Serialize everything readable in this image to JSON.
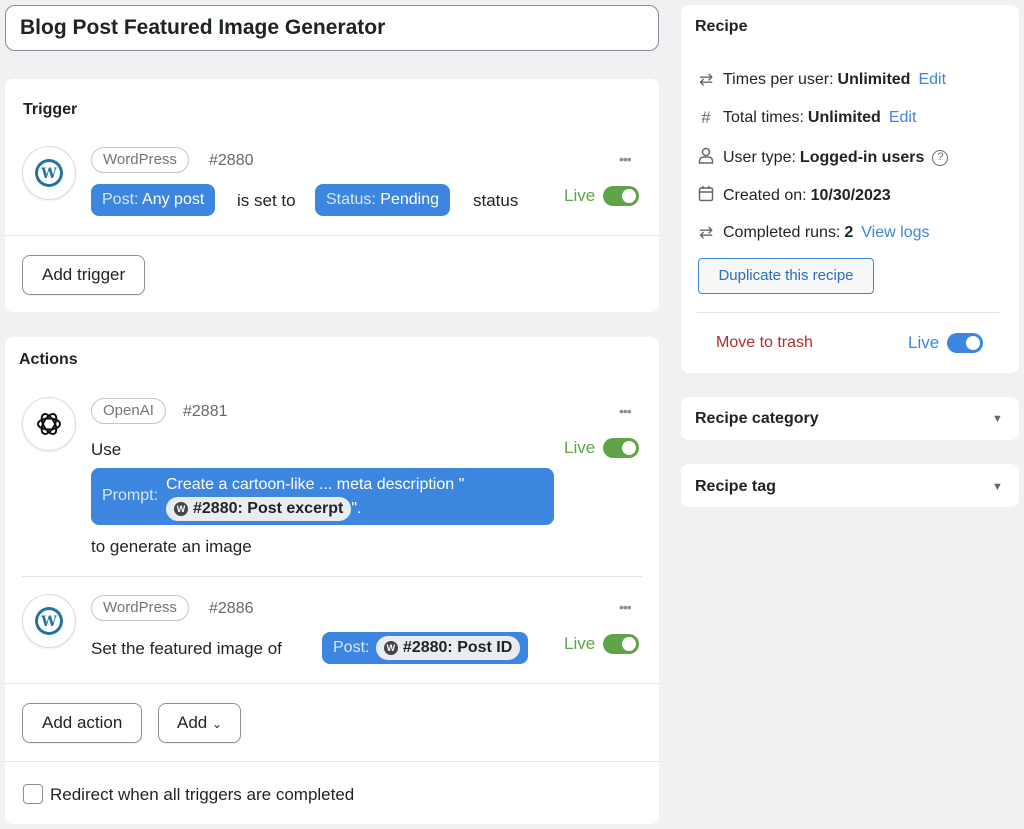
{
  "recipe_title": "Blog Post Featured Image Generator",
  "trigger_section": {
    "title": "Trigger",
    "item": {
      "integration": "WordPress",
      "id": "#2880",
      "post_label": "Post:",
      "post_value": "Any post",
      "text_mid": "is set to",
      "status_label": "Status:",
      "status_value": "Pending",
      "text_end": "status",
      "live": "Live"
    },
    "add_button": "Add trigger"
  },
  "actions_section": {
    "title": "Actions",
    "action1": {
      "integration": "OpenAI",
      "id": "#2881",
      "use": "Use",
      "prompt_label": "Prompt:",
      "prompt_text": "Create a cartoon-like ... meta description \"",
      "token_text": "#2880: Post excerpt",
      "prompt_end": "\".",
      "suffix": "to generate an image",
      "live": "Live"
    },
    "action2": {
      "integration": "WordPress",
      "id": "#2886",
      "text": "Set the featured image of",
      "post_label": "Post:",
      "token_text": "#2880: Post ID",
      "live": "Live"
    },
    "add_action": "Add action",
    "add": "Add",
    "redirect": "Redirect when all triggers are completed"
  },
  "sidebar": {
    "recipe_title": "Recipe",
    "times_per_user_label": "Times per user:",
    "times_per_user_value": "Unlimited",
    "total_times_label": "Total times:",
    "total_times_value": "Unlimited",
    "edit": "Edit",
    "user_type_label": "User type:",
    "user_type_value": "Logged-in users",
    "created_label": "Created on:",
    "created_value": "10/30/2023",
    "completed_label": "Completed runs:",
    "completed_value": "2",
    "view_logs": "View logs",
    "duplicate": "Duplicate this recipe",
    "trash": "Move to trash",
    "live": "Live",
    "category": "Recipe category",
    "tag": "Recipe tag"
  },
  "colors": {
    "accent": "#3d86e0",
    "live_green": "#5fa547",
    "trash_red": "#b32d2e"
  }
}
